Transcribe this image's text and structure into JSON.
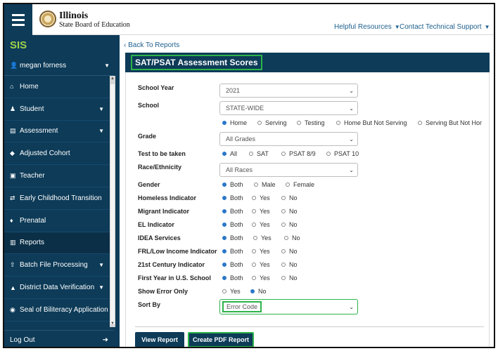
{
  "header": {
    "brand_line1": "Illinois",
    "brand_line2": "State Board of Education",
    "links": [
      "Helpful Resources",
      "Contact Technical Support"
    ]
  },
  "sidebar": {
    "app": "SIS",
    "user": "megan forness",
    "items": [
      {
        "label": "Home",
        "icon": "home-icon",
        "has_caret": false
      },
      {
        "label": "Student",
        "icon": "student-icon",
        "has_caret": true
      },
      {
        "label": "Assessment",
        "icon": "assessment-icon",
        "has_caret": true
      },
      {
        "label": "Adjusted Cohort",
        "icon": "graduation-cap-icon",
        "has_caret": false
      },
      {
        "label": "Teacher",
        "icon": "teacher-icon",
        "has_caret": false
      },
      {
        "label": "Early Childhood Transition",
        "icon": "transfer-icon",
        "has_caret": false
      },
      {
        "label": "Prenatal",
        "icon": "prenatal-icon",
        "has_caret": false
      },
      {
        "label": "Reports",
        "icon": "chart-icon",
        "has_caret": false,
        "active": true
      },
      {
        "label": "Batch File Processing",
        "icon": "upload-icon",
        "has_caret": true
      },
      {
        "label": "District Data Verification",
        "icon": "building-icon",
        "has_caret": true
      },
      {
        "label": "Seal of Biliteracy Application",
        "icon": "globe-icon",
        "has_caret": false
      }
    ],
    "logout": "Log Out"
  },
  "main": {
    "back_link": "Back To Reports",
    "title": "SAT/PSAT Assessment Scores",
    "school_year": {
      "label": "School Year",
      "value": "2021"
    },
    "school": {
      "label": "School",
      "value": "STATE-WIDE",
      "options": [
        "Home",
        "Serving",
        "Testing",
        "Home But Not Serving",
        "Serving But Not Hor"
      ]
    },
    "grade": {
      "label": "Grade",
      "value": "All Grades"
    },
    "test": {
      "label": "Test to be taken",
      "options": [
        "All",
        "SAT",
        "PSAT 8/9",
        "PSAT 10"
      ]
    },
    "race": {
      "label": "Race/Ethnicity",
      "value": "All Races"
    },
    "gender": {
      "label": "Gender",
      "options": [
        "Both",
        "Male",
        "Female"
      ]
    },
    "indicators": [
      {
        "label": "Homeless Indicator",
        "options": [
          "Both",
          "Yes",
          "No"
        ]
      },
      {
        "label": "Migrant Indicator",
        "options": [
          "Both",
          "Yes",
          "No"
        ]
      },
      {
        "label": "EL Indicator",
        "options": [
          "Both",
          "Yes",
          "No"
        ]
      },
      {
        "label": "IDEA Services",
        "options": [
          "Both",
          "Yes",
          "No"
        ]
      },
      {
        "label": "FRL/Low Income Indicator",
        "options": [
          "Both",
          "Yes",
          "No"
        ]
      },
      {
        "label": "21st Century Indicator",
        "options": [
          "Both",
          "Yes",
          "No"
        ]
      },
      {
        "label": "First Year in U.S. School",
        "options": [
          "Both",
          "Yes",
          "No"
        ]
      }
    ],
    "show_error": {
      "label": "Show Error Only",
      "options": [
        "Yes",
        "No"
      ]
    },
    "sort_by": {
      "label": "Sort By",
      "value": "Error Code"
    },
    "view_report": "View Report",
    "create_pdf": "Create PDF Report"
  },
  "colors": {
    "navy": "#0d3b58",
    "highlight": "#2eb34a",
    "link": "#1d5f8e",
    "sis_green": "#9fd24a"
  }
}
